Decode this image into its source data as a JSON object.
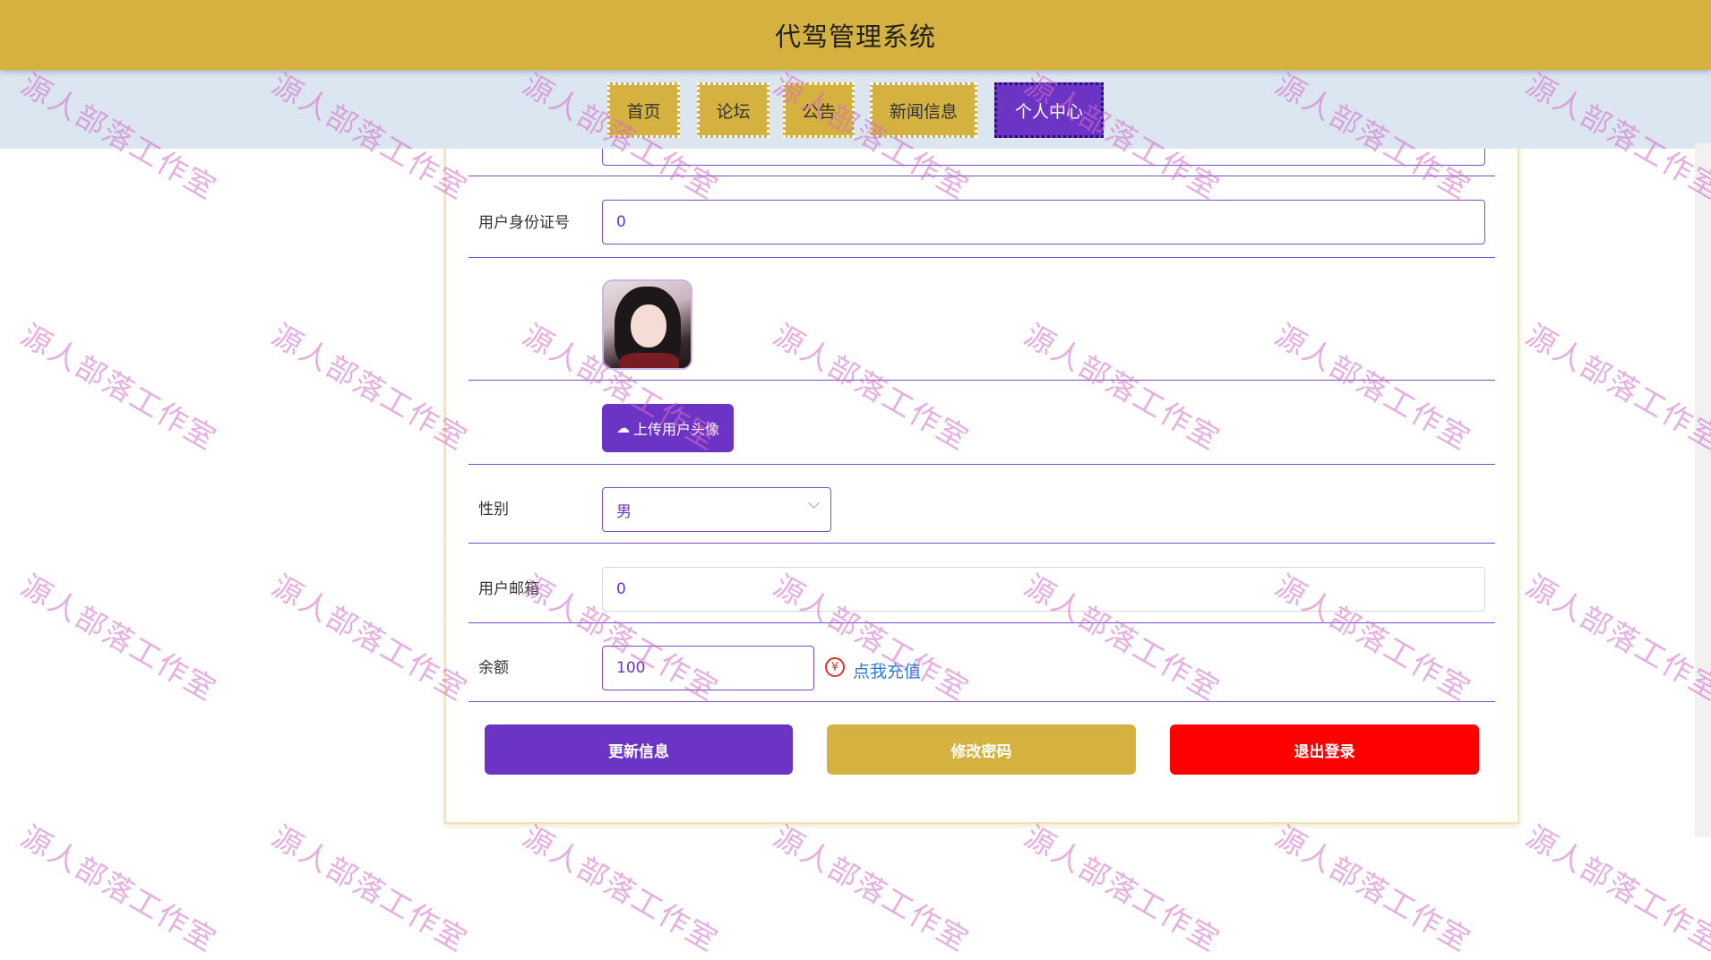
{
  "header": {
    "title": "代驾管理系统"
  },
  "nav": {
    "items": [
      {
        "label": "首页"
      },
      {
        "label": "论坛"
      },
      {
        "label": "公告"
      },
      {
        "label": "新闻信息"
      },
      {
        "label": "个人中心"
      }
    ],
    "active_index": 4
  },
  "form": {
    "id_card": {
      "label": "用户身份证号",
      "value": "0"
    },
    "upload_avatar": {
      "label": "上传用户头像",
      "icon": "cloud-upload-icon"
    },
    "gender": {
      "label": "性别",
      "value": "男"
    },
    "email": {
      "label": "用户邮箱",
      "value": "0"
    },
    "balance": {
      "label": "余额",
      "value": "100",
      "recharge_label": "点我充值",
      "recharge_icon": "yuan-icon"
    }
  },
  "actions": {
    "update_label": "更新信息",
    "change_password_label": "修改密码",
    "logout_label": "退出登录"
  },
  "watermark": {
    "text": "源人部落工作室"
  },
  "colors": {
    "header_bg": "#d5b13f",
    "accent_purple": "#6b34c4",
    "danger_red": "#ff0000",
    "nav_bg": "#dce6f0",
    "link_blue": "#2f7bd8"
  }
}
